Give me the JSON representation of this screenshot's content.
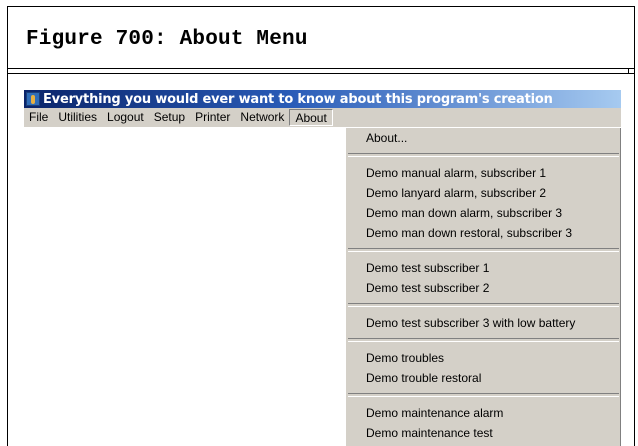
{
  "document": {
    "figure_title": "Figure 700: About Menu"
  },
  "window": {
    "title": "Everything you would ever want to know about this program's creation"
  },
  "menubar": {
    "items": [
      "File",
      "Utilities",
      "Logout",
      "Setup",
      "Printer",
      "Network",
      "About"
    ],
    "open_item": "About"
  },
  "about_menu": {
    "groups": [
      [
        "About..."
      ],
      [
        "Demo manual alarm, subscriber 1",
        "Demo lanyard alarm, subscriber 2",
        "Demo man down alarm, subscriber 3",
        "Demo man down restoral, subscriber 3"
      ],
      [
        "Demo test subscriber 1",
        "Demo test subscriber 2"
      ],
      [
        "Demo test subscriber 3 with low battery"
      ],
      [
        "Demo troubles",
        "Demo trouble restoral"
      ],
      [
        "Demo maintenance alarm",
        "Demo maintenance test"
      ]
    ]
  },
  "colors": {
    "titlebar_start": "#0a246a",
    "titlebar_end": "#a6caf0",
    "menu_face": "#d4d0c8"
  }
}
